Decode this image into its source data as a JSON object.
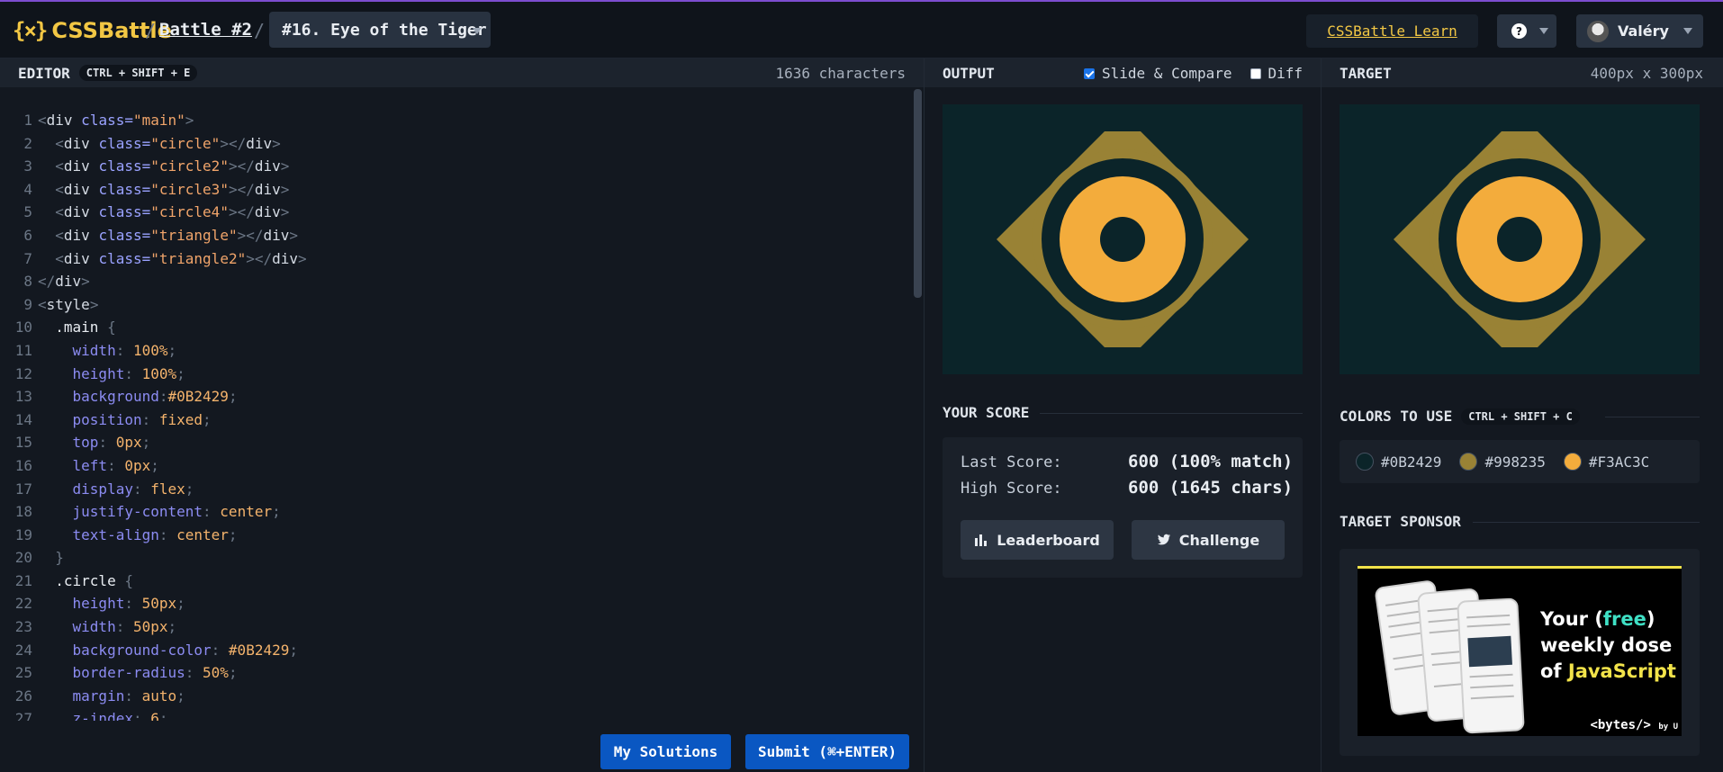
{
  "header": {
    "logo_text": "CSSBattle",
    "logo_mark": "{⨯}",
    "sep": "/",
    "battle_link": "Battle #2",
    "challenge_select": "#16. Eye of the Tiger",
    "learn_link": "CSSBattle Learn",
    "help_label": "?",
    "user_name": "Valéry"
  },
  "editor": {
    "title": "EDITOR",
    "shortcut": "CTRL + SHIFT + E",
    "char_count": "1636 characters",
    "lines": [
      [
        [
          "punc",
          "<"
        ],
        [
          "tg",
          "div"
        ],
        [
          "at",
          " class="
        ],
        [
          "sv",
          "\"main\""
        ],
        [
          "punc",
          ">"
        ]
      ],
      [
        [
          "cl",
          "  "
        ],
        [
          "punc",
          "<"
        ],
        [
          "tg",
          "div"
        ],
        [
          "at",
          " class="
        ],
        [
          "sv",
          "\"circle\""
        ],
        [
          "punc",
          "></"
        ],
        [
          "tg",
          "div"
        ],
        [
          "punc",
          ">"
        ]
      ],
      [
        [
          "cl",
          "  "
        ],
        [
          "punc",
          "<"
        ],
        [
          "tg",
          "div"
        ],
        [
          "at",
          " class="
        ],
        [
          "sv",
          "\"circle2\""
        ],
        [
          "punc",
          "></"
        ],
        [
          "tg",
          "div"
        ],
        [
          "punc",
          ">"
        ]
      ],
      [
        [
          "cl",
          "  "
        ],
        [
          "punc",
          "<"
        ],
        [
          "tg",
          "div"
        ],
        [
          "at",
          " class="
        ],
        [
          "sv",
          "\"circle3\""
        ],
        [
          "punc",
          "></"
        ],
        [
          "tg",
          "div"
        ],
        [
          "punc",
          ">"
        ]
      ],
      [
        [
          "cl",
          "  "
        ],
        [
          "punc",
          "<"
        ],
        [
          "tg",
          "div"
        ],
        [
          "at",
          " class="
        ],
        [
          "sv",
          "\"circle4\""
        ],
        [
          "punc",
          "></"
        ],
        [
          "tg",
          "div"
        ],
        [
          "punc",
          ">"
        ]
      ],
      [
        [
          "cl",
          "  "
        ],
        [
          "punc",
          "<"
        ],
        [
          "tg",
          "div"
        ],
        [
          "at",
          " class="
        ],
        [
          "sv",
          "\"triangle\""
        ],
        [
          "punc",
          "></"
        ],
        [
          "tg",
          "div"
        ],
        [
          "punc",
          ">"
        ]
      ],
      [
        [
          "cl",
          "  "
        ],
        [
          "punc",
          "<"
        ],
        [
          "tg",
          "div"
        ],
        [
          "at",
          " class="
        ],
        [
          "sv",
          "\"triangle2\""
        ],
        [
          "punc",
          "></"
        ],
        [
          "tg",
          "div"
        ],
        [
          "punc",
          ">"
        ]
      ],
      [
        [
          "punc",
          "</"
        ],
        [
          "tg",
          "div"
        ],
        [
          "punc",
          ">"
        ]
      ],
      [
        [
          "punc",
          "<"
        ],
        [
          "tg",
          "style"
        ],
        [
          "punc",
          ">"
        ]
      ],
      [
        [
          "sel",
          "  .main "
        ],
        [
          "punc",
          "{"
        ]
      ],
      [
        [
          "cl",
          "    "
        ],
        [
          "pp",
          "width"
        ],
        [
          "punc",
          ": "
        ],
        [
          "pv",
          "100%"
        ],
        [
          "punc",
          ";"
        ]
      ],
      [
        [
          "cl",
          "    "
        ],
        [
          "pp",
          "height"
        ],
        [
          "punc",
          ": "
        ],
        [
          "pv",
          "100%"
        ],
        [
          "punc",
          ";"
        ]
      ],
      [
        [
          "cl",
          "    "
        ],
        [
          "pp",
          "background"
        ],
        [
          "punc",
          ":"
        ],
        [
          "pv",
          "#0B2429"
        ],
        [
          "punc",
          ";"
        ]
      ],
      [
        [
          "cl",
          "    "
        ],
        [
          "pp",
          "position"
        ],
        [
          "punc",
          ": "
        ],
        [
          "pv",
          "fixed"
        ],
        [
          "punc",
          ";"
        ]
      ],
      [
        [
          "cl",
          "    "
        ],
        [
          "pp",
          "top"
        ],
        [
          "punc",
          ": "
        ],
        [
          "pv",
          "0px"
        ],
        [
          "punc",
          ";"
        ]
      ],
      [
        [
          "cl",
          "    "
        ],
        [
          "pp",
          "left"
        ],
        [
          "punc",
          ": "
        ],
        [
          "pv",
          "0px"
        ],
        [
          "punc",
          ";"
        ]
      ],
      [
        [
          "cl",
          "    "
        ],
        [
          "pp",
          "display"
        ],
        [
          "punc",
          ": "
        ],
        [
          "pv",
          "flex"
        ],
        [
          "punc",
          ";"
        ]
      ],
      [
        [
          "cl",
          "    "
        ],
        [
          "pp",
          "justify-content"
        ],
        [
          "punc",
          ": "
        ],
        [
          "pv",
          "center"
        ],
        [
          "punc",
          ";"
        ]
      ],
      [
        [
          "cl",
          "    "
        ],
        [
          "pp",
          "text-align"
        ],
        [
          "punc",
          ": "
        ],
        [
          "pv",
          "center"
        ],
        [
          "punc",
          ";"
        ]
      ],
      [
        [
          "punc",
          "  }"
        ]
      ],
      [
        [
          "sel",
          "  .circle "
        ],
        [
          "punc",
          "{"
        ]
      ],
      [
        [
          "cl",
          "    "
        ],
        [
          "pp",
          "height"
        ],
        [
          "punc",
          ": "
        ],
        [
          "pv",
          "50px"
        ],
        [
          "punc",
          ";"
        ]
      ],
      [
        [
          "cl",
          "    "
        ],
        [
          "pp",
          "width"
        ],
        [
          "punc",
          ": "
        ],
        [
          "pv",
          "50px"
        ],
        [
          "punc",
          ";"
        ]
      ],
      [
        [
          "cl",
          "    "
        ],
        [
          "pp",
          "background-color"
        ],
        [
          "punc",
          ": "
        ],
        [
          "pv",
          "#0B2429"
        ],
        [
          "punc",
          ";"
        ]
      ],
      [
        [
          "cl",
          "    "
        ],
        [
          "pp",
          "border-radius"
        ],
        [
          "punc",
          ": "
        ],
        [
          "pv",
          "50%"
        ],
        [
          "punc",
          ";"
        ]
      ],
      [
        [
          "cl",
          "    "
        ],
        [
          "pp",
          "margin"
        ],
        [
          "punc",
          ": "
        ],
        [
          "pv",
          "auto"
        ],
        [
          "punc",
          ";"
        ]
      ],
      [
        [
          "cl",
          "    "
        ],
        [
          "pp",
          "z-index"
        ],
        [
          "punc",
          ": "
        ],
        [
          "pv",
          "6"
        ],
        [
          "punc",
          ";"
        ]
      ]
    ],
    "my_solutions": "My Solutions",
    "submit": "Submit (⌘+ENTER)"
  },
  "output": {
    "title": "OUTPUT",
    "slide_compare": "Slide & Compare",
    "slide_compare_checked": true,
    "diff": "Diff",
    "diff_checked": false
  },
  "target": {
    "title": "TARGET",
    "size": "400px x 300px"
  },
  "score": {
    "title": "YOUR SCORE",
    "last_label": "Last Score:",
    "last_value": "600 (100% match)",
    "high_label": "High Score:",
    "high_value": "600 (1645 chars)",
    "leaderboard": "Leaderboard",
    "challenge": "Challenge"
  },
  "colors": {
    "title": "COLORS TO USE",
    "shortcut": "CTRL + SHIFT + C",
    "items": [
      {
        "label": "#0B2429",
        "hex": "#0B2429"
      },
      {
        "label": "#998235",
        "hex": "#998235"
      },
      {
        "label": "#F3AC3C",
        "hex": "#F3AC3C"
      }
    ]
  },
  "sponsor": {
    "title": "TARGET SPONSOR",
    "line1_pre": "Your (",
    "line1_free": "free",
    "line1_post": ")",
    "line2": "weekly dose",
    "line3_pre": "of ",
    "line3_js": "JavaScript",
    "brand": "<bytes/>",
    "brand_by": "by U"
  }
}
